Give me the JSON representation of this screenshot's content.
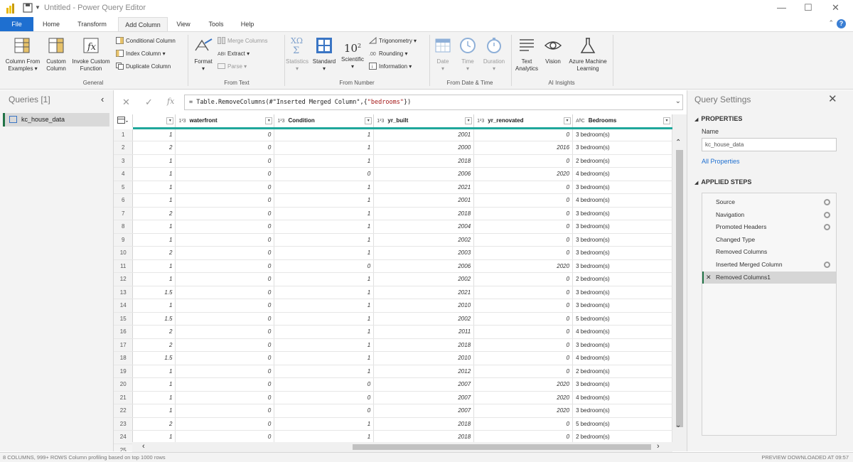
{
  "window": {
    "title": "Untitled - Power Query Editor"
  },
  "tabs": [
    "File",
    "Home",
    "Transform",
    "Add Column",
    "View",
    "Tools",
    "Help"
  ],
  "ribbon": {
    "general": {
      "column_from_examples_line1": "Column From",
      "column_from_examples_line2": "Examples",
      "custom_column_line1": "Custom",
      "custom_column_line2": "Column",
      "invoke_function_line1": "Invoke Custom",
      "invoke_function_line2": "Function",
      "conditional_column": "Conditional Column",
      "index_column": "Index Column",
      "duplicate_column": "Duplicate Column",
      "label": "General"
    },
    "from_text": {
      "format": "Format",
      "merge_columns": "Merge Columns",
      "extract": "Extract",
      "parse": "Parse",
      "label": "From Text"
    },
    "from_number": {
      "statistics": "Statistics",
      "standard": "Standard",
      "scientific": "Scientific",
      "scientific_glyph": "10",
      "scientific_sup": "2",
      "trigonometry": "Trigonometry",
      "rounding": "Rounding",
      "information": "Information",
      "label": "From Number"
    },
    "from_date_time": {
      "date": "Date",
      "time": "Time",
      "duration": "Duration",
      "label": "From Date & Time"
    },
    "ai_insights": {
      "text_analytics_line1": "Text",
      "text_analytics_line2": "Analytics",
      "vision": "Vision",
      "azure_ml_line1": "Azure Machine",
      "azure_ml_line2": "Learning",
      "label": "AI Insights"
    }
  },
  "queries": {
    "header": "Queries [1]",
    "items": [
      "kc_house_data"
    ]
  },
  "formula": {
    "prefix": "= Table.RemoveColumns(#\"Inserted Merged Column\",{",
    "string": "\"bedrooms\"",
    "suffix": "})"
  },
  "grid": {
    "columns": [
      {
        "type": "",
        "name": ""
      },
      {
        "type": "1²3",
        "name": "waterfront"
      },
      {
        "type": "1²3",
        "name": "Condition"
      },
      {
        "type": "1²3",
        "name": "yr_built"
      },
      {
        "type": "1²3",
        "name": "yr_renovated"
      },
      {
        "type": "AᴮC",
        "name": "Bedrooms"
      }
    ],
    "rows": [
      [
        "1",
        "1",
        "0",
        "1",
        "2001",
        "0",
        "3 bedroom(s)"
      ],
      [
        "2",
        "2",
        "0",
        "1",
        "2000",
        "2016",
        "3 bedroom(s)"
      ],
      [
        "3",
        "1",
        "0",
        "1",
        "2018",
        "0",
        "2 bedroom(s)"
      ],
      [
        "4",
        "1",
        "0",
        "0",
        "2006",
        "2020",
        "4 bedroom(s)"
      ],
      [
        "5",
        "1",
        "0",
        "1",
        "2021",
        "0",
        "3 bedroom(s)"
      ],
      [
        "6",
        "1",
        "0",
        "1",
        "2001",
        "0",
        "4 bedroom(s)"
      ],
      [
        "7",
        "2",
        "0",
        "1",
        "2018",
        "0",
        "3 bedroom(s)"
      ],
      [
        "8",
        "1",
        "0",
        "1",
        "2004",
        "0",
        "3 bedroom(s)"
      ],
      [
        "9",
        "1",
        "0",
        "1",
        "2002",
        "0",
        "3 bedroom(s)"
      ],
      [
        "10",
        "2",
        "0",
        "1",
        "2003",
        "0",
        "3 bedroom(s)"
      ],
      [
        "11",
        "1",
        "0",
        "0",
        "2006",
        "2020",
        "3 bedroom(s)"
      ],
      [
        "12",
        "1",
        "0",
        "1",
        "2002",
        "0",
        "2 bedroom(s)"
      ],
      [
        "13",
        "1.5",
        "0",
        "1",
        "2021",
        "0",
        "3 bedroom(s)"
      ],
      [
        "14",
        "1",
        "0",
        "1",
        "2010",
        "0",
        "3 bedroom(s)"
      ],
      [
        "15",
        "1.5",
        "0",
        "1",
        "2002",
        "0",
        "5 bedroom(s)"
      ],
      [
        "16",
        "2",
        "0",
        "1",
        "2011",
        "0",
        "4 bedroom(s)"
      ],
      [
        "17",
        "2",
        "0",
        "1",
        "2018",
        "0",
        "3 bedroom(s)"
      ],
      [
        "18",
        "1.5",
        "0",
        "1",
        "2010",
        "0",
        "4 bedroom(s)"
      ],
      [
        "19",
        "1",
        "0",
        "1",
        "2012",
        "0",
        "2 bedroom(s)"
      ],
      [
        "20",
        "1",
        "0",
        "0",
        "2007",
        "2020",
        "3 bedroom(s)"
      ],
      [
        "21",
        "1",
        "0",
        "0",
        "2007",
        "2020",
        "4 bedroom(s)"
      ],
      [
        "22",
        "1",
        "0",
        "0",
        "2007",
        "2020",
        "3 bedroom(s)"
      ],
      [
        "23",
        "2",
        "0",
        "1",
        "2018",
        "0",
        "5 bedroom(s)"
      ],
      [
        "24",
        "1",
        "0",
        "1",
        "2018",
        "0",
        "2 bedroom(s)"
      ],
      [
        "25",
        "",
        "",
        "",
        "",
        "",
        ""
      ]
    ]
  },
  "settings": {
    "header": "Query Settings",
    "properties_label": "PROPERTIES",
    "name_label": "Name",
    "name_value": "kc_house_data",
    "all_properties": "All Properties",
    "applied_steps_label": "APPLIED STEPS",
    "steps": [
      {
        "name": "Source",
        "gear": true
      },
      {
        "name": "Navigation",
        "gear": true
      },
      {
        "name": "Promoted Headers",
        "gear": true
      },
      {
        "name": "Changed Type",
        "gear": false
      },
      {
        "name": "Removed Columns",
        "gear": false
      },
      {
        "name": "Inserted Merged Column",
        "gear": true
      },
      {
        "name": "Removed Columns1",
        "gear": false,
        "selected": true
      }
    ]
  },
  "status": {
    "left": "8 COLUMNS, 999+ ROWS     Column profiling based on top 1000 rows",
    "right": "PREVIEW DOWNLOADED AT 09:57"
  },
  "colors": {
    "accent": "#1e6fd0",
    "header_underline": "#1fa79b",
    "selection_bar": "#217346"
  }
}
